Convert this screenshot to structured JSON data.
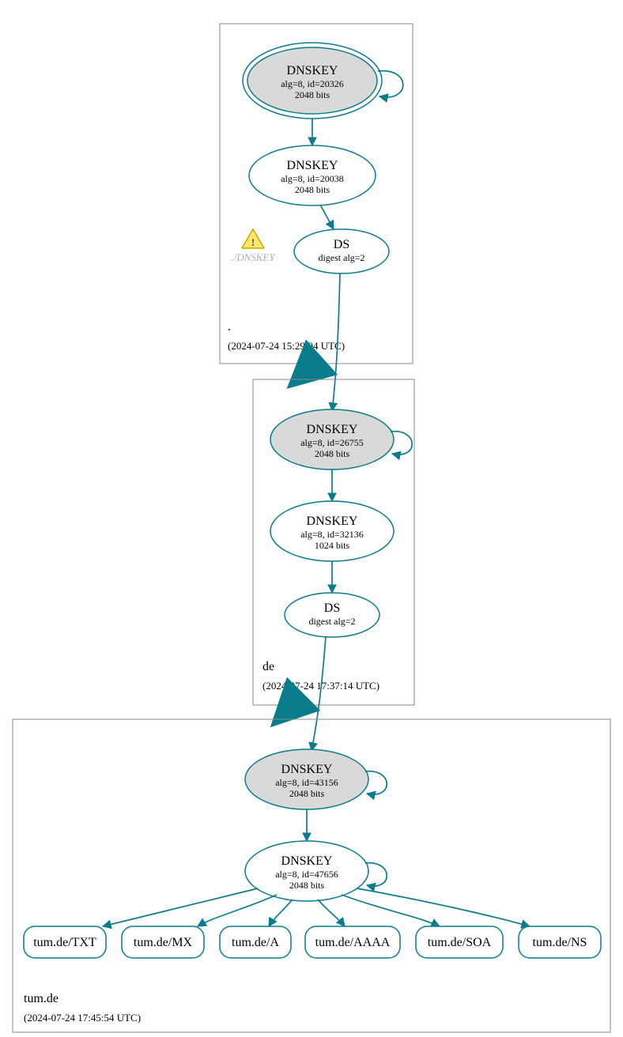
{
  "colors": {
    "stroke": "#0a7c8c",
    "fill_grey": "#d9d9d9",
    "box": "#888888"
  },
  "zones": {
    "root": {
      "label": ".",
      "timestamp": "(2024-07-24 15:29:04 UTC)"
    },
    "de": {
      "label": "de",
      "timestamp": "(2024-07-24 17:37:14 UTC)"
    },
    "tum": {
      "label": "tum.de",
      "timestamp": "(2024-07-24 17:45:54 UTC)"
    }
  },
  "nodes": {
    "root_ksk": {
      "title": "DNSKEY",
      "line1": "alg=8, id=20326",
      "line2": "2048 bits"
    },
    "root_zsk": {
      "title": "DNSKEY",
      "line1": "alg=8, id=20038",
      "line2": "2048 bits"
    },
    "root_ds": {
      "title": "DS",
      "line1": "digest alg=2"
    },
    "root_warn": {
      "label": "./DNSKEY"
    },
    "de_ksk": {
      "title": "DNSKEY",
      "line1": "alg=8, id=26755",
      "line2": "2048 bits"
    },
    "de_zsk": {
      "title": "DNSKEY",
      "line1": "alg=8, id=32136",
      "line2": "1024 bits"
    },
    "de_ds": {
      "title": "DS",
      "line1": "digest alg=2"
    },
    "tum_ksk": {
      "title": "DNSKEY",
      "line1": "alg=8, id=43156",
      "line2": "2048 bits"
    },
    "tum_zsk": {
      "title": "DNSKEY",
      "line1": "alg=8, id=47656",
      "line2": "2048 bits"
    }
  },
  "rrsets": {
    "txt": "tum.de/TXT",
    "mx": "tum.de/MX",
    "a": "tum.de/A",
    "aaaa": "tum.de/AAAA",
    "soa": "tum.de/SOA",
    "ns": "tum.de/NS"
  }
}
